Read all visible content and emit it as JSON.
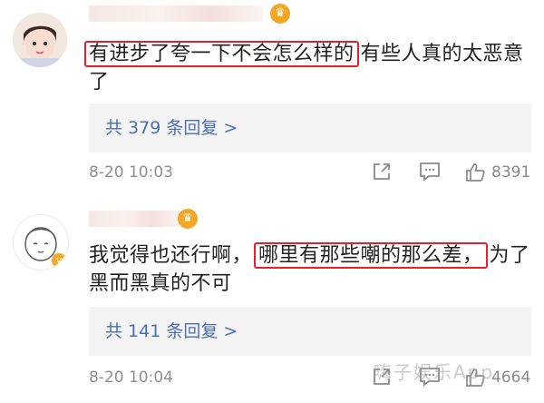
{
  "comments": [
    {
      "text_before": "",
      "text_highlight": "有进步了夸一下不会怎么样的",
      "text_after": "有些人真的太恶意了",
      "replies_label": "共 379 条回复 >",
      "timestamp": "8-20 10:03",
      "likes": "8391"
    },
    {
      "text_before": "我觉得也还行啊，",
      "text_highlight": "哪里有那些嘲的那么差，",
      "text_after": "为了黑而黑真的不可",
      "replies_label": "共 141 条回复 >",
      "timestamp": "8-20 10:04",
      "likes": "4664"
    }
  ],
  "watermark": "嗨子娱乐App",
  "colors": {
    "highlight_border": "#e5212b",
    "link": "#4a6fb5",
    "reply_bg": "#f4f4f5",
    "muted": "#8e8e8e"
  },
  "icons": {
    "share": "share-icon",
    "comment": "comment-icon",
    "like": "thumbs-up-icon",
    "badge": "crown-badge-icon"
  }
}
